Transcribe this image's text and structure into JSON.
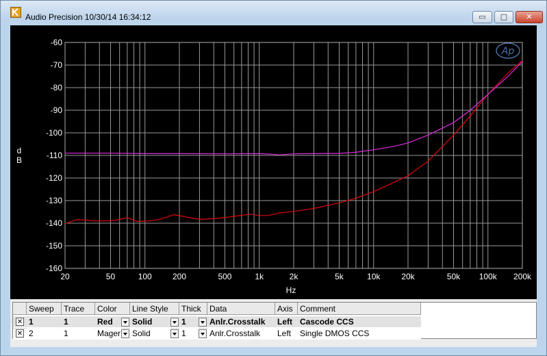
{
  "window": {
    "title": "Audio Precision  10/30/14 16:34:12"
  },
  "controls": {
    "minimize": "▭",
    "maximize": "□",
    "close": "✕"
  },
  "logo": {
    "text": "Ap",
    "color": "#4a6fa5"
  },
  "chart_data": {
    "type": "line",
    "title": "",
    "xlabel": "Hz",
    "ylabel": "dB",
    "xscale": "log",
    "xlim": [
      20,
      200000
    ],
    "ylim": [
      -160,
      -60
    ],
    "grid": true,
    "xticks": [
      {
        "v": 20,
        "label": "20"
      },
      {
        "v": 50,
        "label": "50"
      },
      {
        "v": 100,
        "label": "100"
      },
      {
        "v": 200,
        "label": "200"
      },
      {
        "v": 500,
        "label": "500"
      },
      {
        "v": 1000,
        "label": "1k"
      },
      {
        "v": 2000,
        "label": "2k"
      },
      {
        "v": 5000,
        "label": "5k"
      },
      {
        "v": 10000,
        "label": "10k"
      },
      {
        "v": 20000,
        "label": "20k"
      },
      {
        "v": 50000,
        "label": "50k"
      },
      {
        "v": 100000,
        "label": "100k"
      },
      {
        "v": 200000,
        "label": "200k"
      }
    ],
    "yticks": [
      -60,
      -70,
      -80,
      -90,
      -100,
      -110,
      -120,
      -130,
      -140,
      -150,
      -160
    ],
    "series": [
      {
        "color": "#e0000e",
        "points": [
          [
            20,
            -140.2
          ],
          [
            25,
            -138.5
          ],
          [
            30,
            -138.5
          ],
          [
            35,
            -139.0
          ],
          [
            45,
            -139.0
          ],
          [
            55,
            -138.8
          ],
          [
            70,
            -137.5
          ],
          [
            85,
            -139.2
          ],
          [
            110,
            -139.0
          ],
          [
            130,
            -138.4
          ],
          [
            150,
            -137.5
          ],
          [
            180,
            -136.2
          ],
          [
            250,
            -137.6
          ],
          [
            300,
            -138.3
          ],
          [
            400,
            -138.0
          ],
          [
            500,
            -137.5
          ],
          [
            700,
            -136.5
          ],
          [
            850,
            -136.0
          ],
          [
            1000,
            -136.6
          ],
          [
            1200,
            -136.6
          ],
          [
            1500,
            -135.5
          ],
          [
            2000,
            -134.8
          ],
          [
            3000,
            -133.5
          ],
          [
            5000,
            -131.0
          ],
          [
            7000,
            -129.0
          ],
          [
            10000,
            -126.0
          ],
          [
            15000,
            -122.0
          ],
          [
            20000,
            -119.0
          ],
          [
            30000,
            -112.5
          ],
          [
            50000,
            -101.0
          ],
          [
            70000,
            -92.5
          ],
          [
            100000,
            -83.0
          ],
          [
            150000,
            -73.5
          ],
          [
            200000,
            -68.0
          ]
        ]
      },
      {
        "color": "#e02ce0",
        "points": [
          [
            20,
            -109.0
          ],
          [
            50,
            -109.0
          ],
          [
            100,
            -109.2
          ],
          [
            200,
            -109.2
          ],
          [
            500,
            -109.3
          ],
          [
            1000,
            -109.2
          ],
          [
            1300,
            -109.5
          ],
          [
            1500,
            -109.8
          ],
          [
            2000,
            -109.3
          ],
          [
            3000,
            -109.2
          ],
          [
            5000,
            -109.1
          ],
          [
            7000,
            -108.6
          ],
          [
            10000,
            -107.5
          ],
          [
            15000,
            -106.0
          ],
          [
            20000,
            -104.5
          ],
          [
            30000,
            -101.0
          ],
          [
            50000,
            -95.5
          ],
          [
            70000,
            -90.0
          ],
          [
            100000,
            -83.0
          ],
          [
            150000,
            -75.0
          ],
          [
            200000,
            -68.5
          ]
        ]
      }
    ]
  },
  "table": {
    "headers": [
      "Sweep",
      "Trace",
      "Color",
      "Line Style",
      "Thick",
      "Data",
      "Axis",
      "Comment"
    ],
    "rows": [
      {
        "checked": "✕",
        "sweep": "1",
        "trace": "1",
        "color": "Red",
        "style": "Solid",
        "thick": "1",
        "data": "Anlr.Crosstalk",
        "axis": "Left",
        "comment": "Cascode CCS"
      },
      {
        "checked": "✕",
        "sweep": "2",
        "trace": "1",
        "color": "Mager",
        "style": "Solid",
        "thick": "1",
        "data": "Anlr.Crosstalk",
        "axis": "Left",
        "comment": "Single DMOS CCS"
      }
    ]
  }
}
